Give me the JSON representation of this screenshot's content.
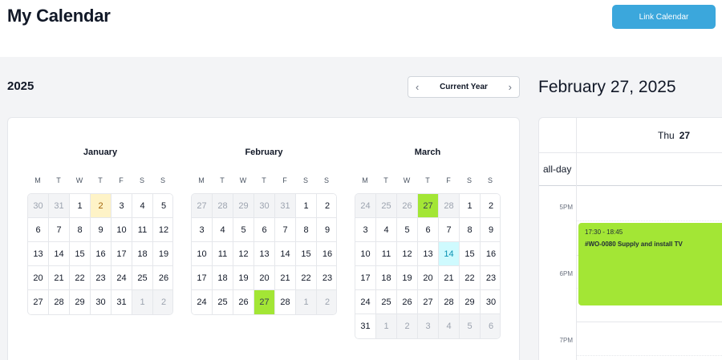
{
  "header": {
    "title": "My Calendar",
    "link_button": "Link Calendar"
  },
  "year_view": {
    "year": "2025",
    "nav": {
      "label": "Current Year",
      "prev_icon": "chevron-left-icon",
      "next_icon": "chevron-right-icon"
    },
    "weekdays": [
      "M",
      "T",
      "W",
      "T",
      "F",
      "S",
      "S"
    ],
    "months": [
      {
        "name": "January",
        "weeks": [
          [
            [
              30,
              "other"
            ],
            [
              31,
              "other"
            ],
            [
              1,
              ""
            ],
            [
              2,
              "today"
            ],
            [
              3,
              ""
            ],
            [
              4,
              ""
            ],
            [
              5,
              ""
            ]
          ],
          [
            [
              6,
              ""
            ],
            [
              7,
              ""
            ],
            [
              8,
              ""
            ],
            [
              9,
              ""
            ],
            [
              10,
              ""
            ],
            [
              11,
              ""
            ],
            [
              12,
              ""
            ]
          ],
          [
            [
              13,
              ""
            ],
            [
              14,
              ""
            ],
            [
              15,
              ""
            ],
            [
              16,
              ""
            ],
            [
              17,
              ""
            ],
            [
              18,
              ""
            ],
            [
              19,
              ""
            ]
          ],
          [
            [
              20,
              ""
            ],
            [
              21,
              ""
            ],
            [
              22,
              ""
            ],
            [
              23,
              ""
            ],
            [
              24,
              ""
            ],
            [
              25,
              ""
            ],
            [
              26,
              ""
            ]
          ],
          [
            [
              27,
              ""
            ],
            [
              28,
              ""
            ],
            [
              29,
              ""
            ],
            [
              30,
              ""
            ],
            [
              31,
              ""
            ],
            [
              1,
              "other"
            ],
            [
              2,
              "other"
            ]
          ]
        ]
      },
      {
        "name": "February",
        "weeks": [
          [
            [
              27,
              "other"
            ],
            [
              28,
              "other"
            ],
            [
              29,
              "other"
            ],
            [
              30,
              "other"
            ],
            [
              31,
              "other"
            ],
            [
              1,
              ""
            ],
            [
              2,
              ""
            ]
          ],
          [
            [
              3,
              ""
            ],
            [
              4,
              ""
            ],
            [
              5,
              ""
            ],
            [
              6,
              ""
            ],
            [
              7,
              ""
            ],
            [
              8,
              ""
            ],
            [
              9,
              ""
            ]
          ],
          [
            [
              10,
              ""
            ],
            [
              11,
              ""
            ],
            [
              12,
              ""
            ],
            [
              13,
              ""
            ],
            [
              14,
              ""
            ],
            [
              15,
              ""
            ],
            [
              16,
              ""
            ]
          ],
          [
            [
              17,
              ""
            ],
            [
              18,
              ""
            ],
            [
              19,
              ""
            ],
            [
              20,
              ""
            ],
            [
              21,
              ""
            ],
            [
              22,
              ""
            ],
            [
              23,
              ""
            ]
          ],
          [
            [
              24,
              ""
            ],
            [
              25,
              ""
            ],
            [
              26,
              ""
            ],
            [
              27,
              "selected"
            ],
            [
              28,
              ""
            ],
            [
              1,
              "other"
            ],
            [
              2,
              "other"
            ]
          ]
        ]
      },
      {
        "name": "March",
        "weeks": [
          [
            [
              24,
              "other"
            ],
            [
              25,
              "other"
            ],
            [
              26,
              "other"
            ],
            [
              27,
              "selected"
            ],
            [
              28,
              "other"
            ],
            [
              1,
              ""
            ],
            [
              2,
              ""
            ]
          ],
          [
            [
              3,
              ""
            ],
            [
              4,
              ""
            ],
            [
              5,
              ""
            ],
            [
              6,
              ""
            ],
            [
              7,
              ""
            ],
            [
              8,
              ""
            ],
            [
              9,
              ""
            ]
          ],
          [
            [
              10,
              ""
            ],
            [
              11,
              ""
            ],
            [
              12,
              ""
            ],
            [
              13,
              ""
            ],
            [
              14,
              "highlight"
            ],
            [
              15,
              ""
            ],
            [
              16,
              ""
            ]
          ],
          [
            [
              17,
              ""
            ],
            [
              18,
              ""
            ],
            [
              19,
              ""
            ],
            [
              20,
              ""
            ],
            [
              21,
              ""
            ],
            [
              22,
              ""
            ],
            [
              23,
              ""
            ]
          ],
          [
            [
              24,
              ""
            ],
            [
              25,
              ""
            ],
            [
              26,
              ""
            ],
            [
              27,
              ""
            ],
            [
              28,
              ""
            ],
            [
              29,
              ""
            ],
            [
              30,
              ""
            ]
          ],
          [
            [
              31,
              ""
            ],
            [
              1,
              "other"
            ],
            [
              2,
              "other"
            ],
            [
              3,
              "other"
            ],
            [
              4,
              "other"
            ],
            [
              5,
              "other"
            ],
            [
              6,
              "other"
            ]
          ]
        ]
      }
    ]
  },
  "day_view": {
    "title": "February 27, 2025",
    "weekday": "Thu",
    "day_number": "27",
    "allday_label": "all-day",
    "hours": [
      "5PM",
      "6PM",
      "7PM"
    ],
    "event": {
      "time": "17:30 - 18:45",
      "title": "#WO-0080 Supply and install TV",
      "color": "#a3e635"
    }
  },
  "colors": {
    "accent": "#3ba7dc",
    "today_bg": "#fef3c7",
    "selected_bg": "#a3e635",
    "highlight_bg": "#cffafe"
  }
}
